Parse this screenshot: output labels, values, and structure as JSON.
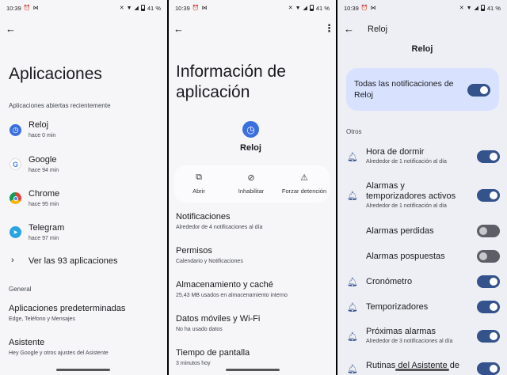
{
  "status_bar": {
    "time": "10:39",
    "battery": "41 %"
  },
  "panel1": {
    "title": "Aplicaciones",
    "recent_header": "Aplicaciones abiertas recientemente",
    "apps": [
      {
        "name": "Reloj",
        "time": "hace 0 min",
        "icon": "clock-icon",
        "color": "#3a6fe0"
      },
      {
        "name": "Google",
        "time": "hace 94 min",
        "icon": "google-icon",
        "color": "#4285f4"
      },
      {
        "name": "Chrome",
        "time": "hace 95 min",
        "icon": "chrome-icon",
        "color": "#db4437"
      },
      {
        "name": "Telegram",
        "time": "hace 97 min",
        "icon": "telegram-icon",
        "color": "#2aa3de"
      }
    ],
    "see_all": "Ver las 93 aplicaciones",
    "general_header": "General",
    "general_items": [
      {
        "title": "Aplicaciones predeterminadas",
        "sub": "Edge, Teléfono y Mensajes"
      },
      {
        "title": "Asistente",
        "sub": "Hey Google y otros ajustes del Asistente"
      }
    ]
  },
  "panel2": {
    "title_line1": "Información de",
    "title_line2": "aplicación",
    "app_name": "Reloj",
    "actions": [
      {
        "label": "Abrir",
        "icon": "open-icon"
      },
      {
        "label": "Inhabilitar",
        "icon": "disable-icon"
      },
      {
        "label": "Forzar detención",
        "icon": "warning-icon"
      }
    ],
    "items": [
      {
        "title": "Notificaciones",
        "sub": "Alrededor de 4 notificaciones al día"
      },
      {
        "title": "Permisos",
        "sub": "Calendario y Notificaciones"
      },
      {
        "title": "Almacenamiento y caché",
        "sub": "25,43 MB usados en almacenamiento interno"
      },
      {
        "title": "Datos móviles y Wi-Fi",
        "sub": "No ha usado datos"
      },
      {
        "title": "Tiempo de pantalla",
        "sub": "3 minutos hoy"
      }
    ]
  },
  "panel3": {
    "header": "Reloj",
    "app_label": "Reloj",
    "all_notifs_line1": "Todas las notificaciones de",
    "all_notifs_line2": "Reloj",
    "all_notifs_on": true,
    "others_header": "Otros",
    "channels": [
      {
        "title_lines": [
          "Hora de dormir"
        ],
        "sub": "Alrededor de 1 notificación al día",
        "on": true,
        "bell": true
      },
      {
        "title_lines": [
          "Alarmas y",
          "temporizadores activos"
        ],
        "sub": "Alrededor de 1 notificación al día",
        "on": true,
        "bell": true
      },
      {
        "title_lines": [
          "Alarmas perdidas"
        ],
        "sub": "",
        "on": false,
        "bell": false
      },
      {
        "title_lines": [
          "Alarmas pospuestas"
        ],
        "sub": "",
        "on": false,
        "bell": false
      },
      {
        "title_lines": [
          "Cronómetro"
        ],
        "sub": "",
        "on": true,
        "bell": true
      },
      {
        "title_lines": [
          "Temporizadores"
        ],
        "sub": "",
        "on": true,
        "bell": true
      },
      {
        "title_lines": [
          "Próximas alarmas"
        ],
        "sub": "Alrededor de 3 notificaciones al día",
        "on": true,
        "bell": true
      },
      {
        "title_lines": [
          "Rutinas del Asistente de"
        ],
        "sub": "",
        "on": true,
        "bell": true
      }
    ]
  }
}
